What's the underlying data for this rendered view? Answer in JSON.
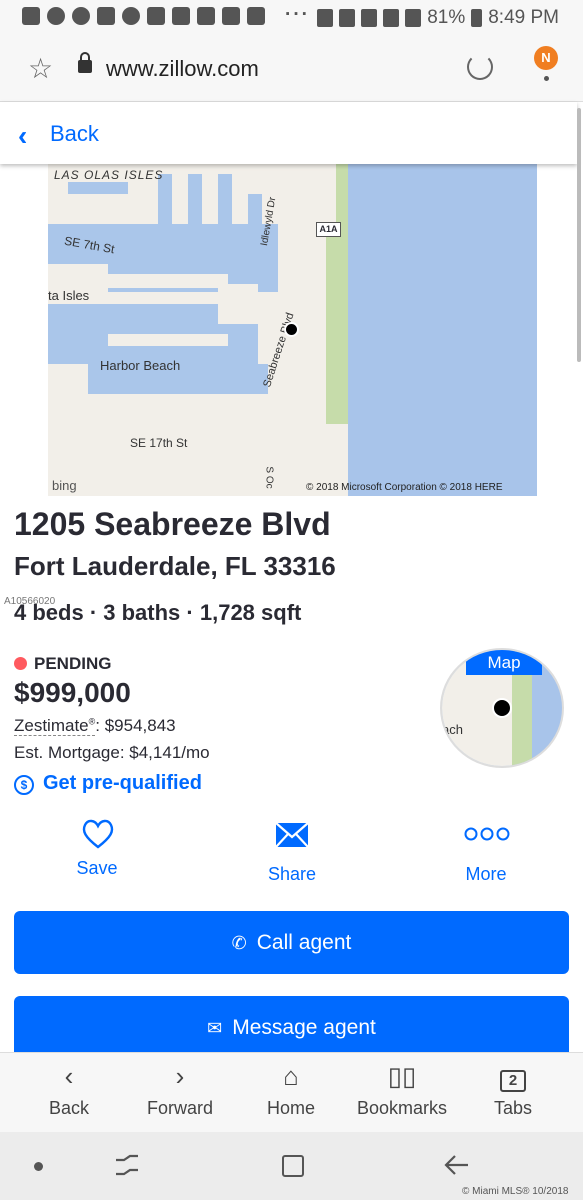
{
  "status_bar": {
    "battery": "81%",
    "time": "8:49 PM",
    "dots": "···"
  },
  "browser": {
    "url": "www.zillow.com",
    "avatar_initial": "N"
  },
  "header": {
    "back_label": "Back"
  },
  "map": {
    "labels": {
      "las_olas": "LAS OLAS ISLES",
      "se7": "SE 7th St",
      "isles": "ta Isles",
      "idlewyld": "Idlewyld Dr",
      "a1a": "A1A",
      "seabreeze": "Seabreeze Blvd",
      "harbor": "Harbor Beach",
      "se17": "SE 17th St",
      "socean": "S Oc"
    },
    "attribution": "© 2018 Microsoft Corporation © 2018 HERE",
    "provider": "bing"
  },
  "listing": {
    "address_line1": "1205 Seabreeze Blvd",
    "address_line2": "Fort Lauderdale, FL 33316",
    "mls_id": "A10566020",
    "beds": "4 beds",
    "baths": "3 baths",
    "sqft": "1,728 sqft",
    "separator": " · ",
    "status": "PENDING",
    "price": "$999,000",
    "zestimate_label": "Zestimate",
    "zestimate_mark": "®",
    "zestimate_value": ": $954,843",
    "mortgage": "Est. Mortgage: $4,141/mo",
    "prequal": "Get pre-qualified",
    "prequal_icon": "$",
    "minimap_label": "Map",
    "minimap_text": "ach"
  },
  "actions": {
    "save": "Save",
    "share": "Share",
    "more": "More",
    "call_agent": "Call agent",
    "message_agent": "Message agent"
  },
  "bottom_nav": {
    "back": "Back",
    "forward": "Forward",
    "home": "Home",
    "bookmarks": "Bookmarks",
    "tabs": "Tabs",
    "tab_count": "2"
  },
  "watermark": "© Miami MLS® 10/2018",
  "colors": {
    "accent": "#006aff",
    "pending": "#ff5a5f",
    "badge": "#f07e21"
  }
}
